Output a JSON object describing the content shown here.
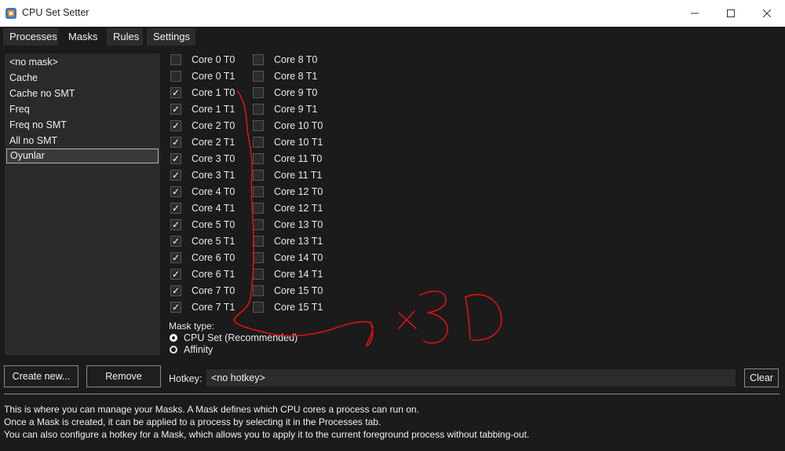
{
  "window": {
    "title": "CPU Set Setter",
    "icons": {
      "app": "cpu-app-icon",
      "minimize": "minimize-icon",
      "maximize": "maximize-icon",
      "close": "close-icon"
    }
  },
  "tabs": [
    {
      "label": "Processes",
      "active": false
    },
    {
      "label": "Masks",
      "active": true
    },
    {
      "label": "Rules",
      "active": false
    },
    {
      "label": "Settings",
      "active": false
    }
  ],
  "masks": {
    "items": [
      "<no mask>",
      "Cache",
      "Cache no SMT",
      "Freq",
      "Freq no SMT",
      "All no SMT",
      "Oyunlar"
    ],
    "selected_index": 6
  },
  "cores": {
    "left": [
      {
        "label": "Core 0 T0",
        "checked": false
      },
      {
        "label": "Core 0 T1",
        "checked": false
      },
      {
        "label": "Core 1 T0",
        "checked": true
      },
      {
        "label": "Core 1 T1",
        "checked": true
      },
      {
        "label": "Core 2 T0",
        "checked": true
      },
      {
        "label": "Core 2 T1",
        "checked": true
      },
      {
        "label": "Core 3 T0",
        "checked": true
      },
      {
        "label": "Core 3 T1",
        "checked": true
      },
      {
        "label": "Core 4 T0",
        "checked": true
      },
      {
        "label": "Core 4 T1",
        "checked": true
      },
      {
        "label": "Core 5 T0",
        "checked": true
      },
      {
        "label": "Core 5 T1",
        "checked": true
      },
      {
        "label": "Core 6 T0",
        "checked": true
      },
      {
        "label": "Core 6 T1",
        "checked": true
      },
      {
        "label": "Core 7 T0",
        "checked": true
      },
      {
        "label": "Core 7 T1",
        "checked": true
      }
    ],
    "right": [
      {
        "label": "Core 8 T0",
        "checked": false
      },
      {
        "label": "Core 8 T1",
        "checked": false
      },
      {
        "label": "Core 9 T0",
        "checked": false
      },
      {
        "label": "Core 9 T1",
        "checked": false
      },
      {
        "label": "Core 10 T0",
        "checked": false
      },
      {
        "label": "Core 10 T1",
        "checked": false
      },
      {
        "label": "Core 11 T0",
        "checked": false
      },
      {
        "label": "Core 11 T1",
        "checked": false
      },
      {
        "label": "Core 12 T0",
        "checked": false
      },
      {
        "label": "Core 12 T1",
        "checked": false
      },
      {
        "label": "Core 13 T0",
        "checked": false
      },
      {
        "label": "Core 13 T1",
        "checked": false
      },
      {
        "label": "Core 14 T0",
        "checked": false
      },
      {
        "label": "Core 14 T1",
        "checked": false
      },
      {
        "label": "Core 15 T0",
        "checked": false
      },
      {
        "label": "Core 15 T1",
        "checked": false
      }
    ]
  },
  "mask_type": {
    "label": "Mask type:",
    "options": [
      {
        "label": "CPU Set (Recommended)",
        "selected": true
      },
      {
        "label": "Affinity",
        "selected": false
      }
    ]
  },
  "buttons": {
    "create": "Create new...",
    "remove": "Remove",
    "clear": "Clear"
  },
  "hotkey": {
    "label": "Hotkey:",
    "value": "<no hotkey>"
  },
  "help": [
    "This is where you can manage your Masks. A Mask defines which CPU cores a process can run on.",
    "Once a Mask is created, it can be applied to a process by selecting it in the Processes tab.",
    "You can also configure a hotkey for a Mask, which allows you to apply it to the current foreground process without tabbing-out."
  ],
  "annotation": {
    "color": "#e01010"
  }
}
